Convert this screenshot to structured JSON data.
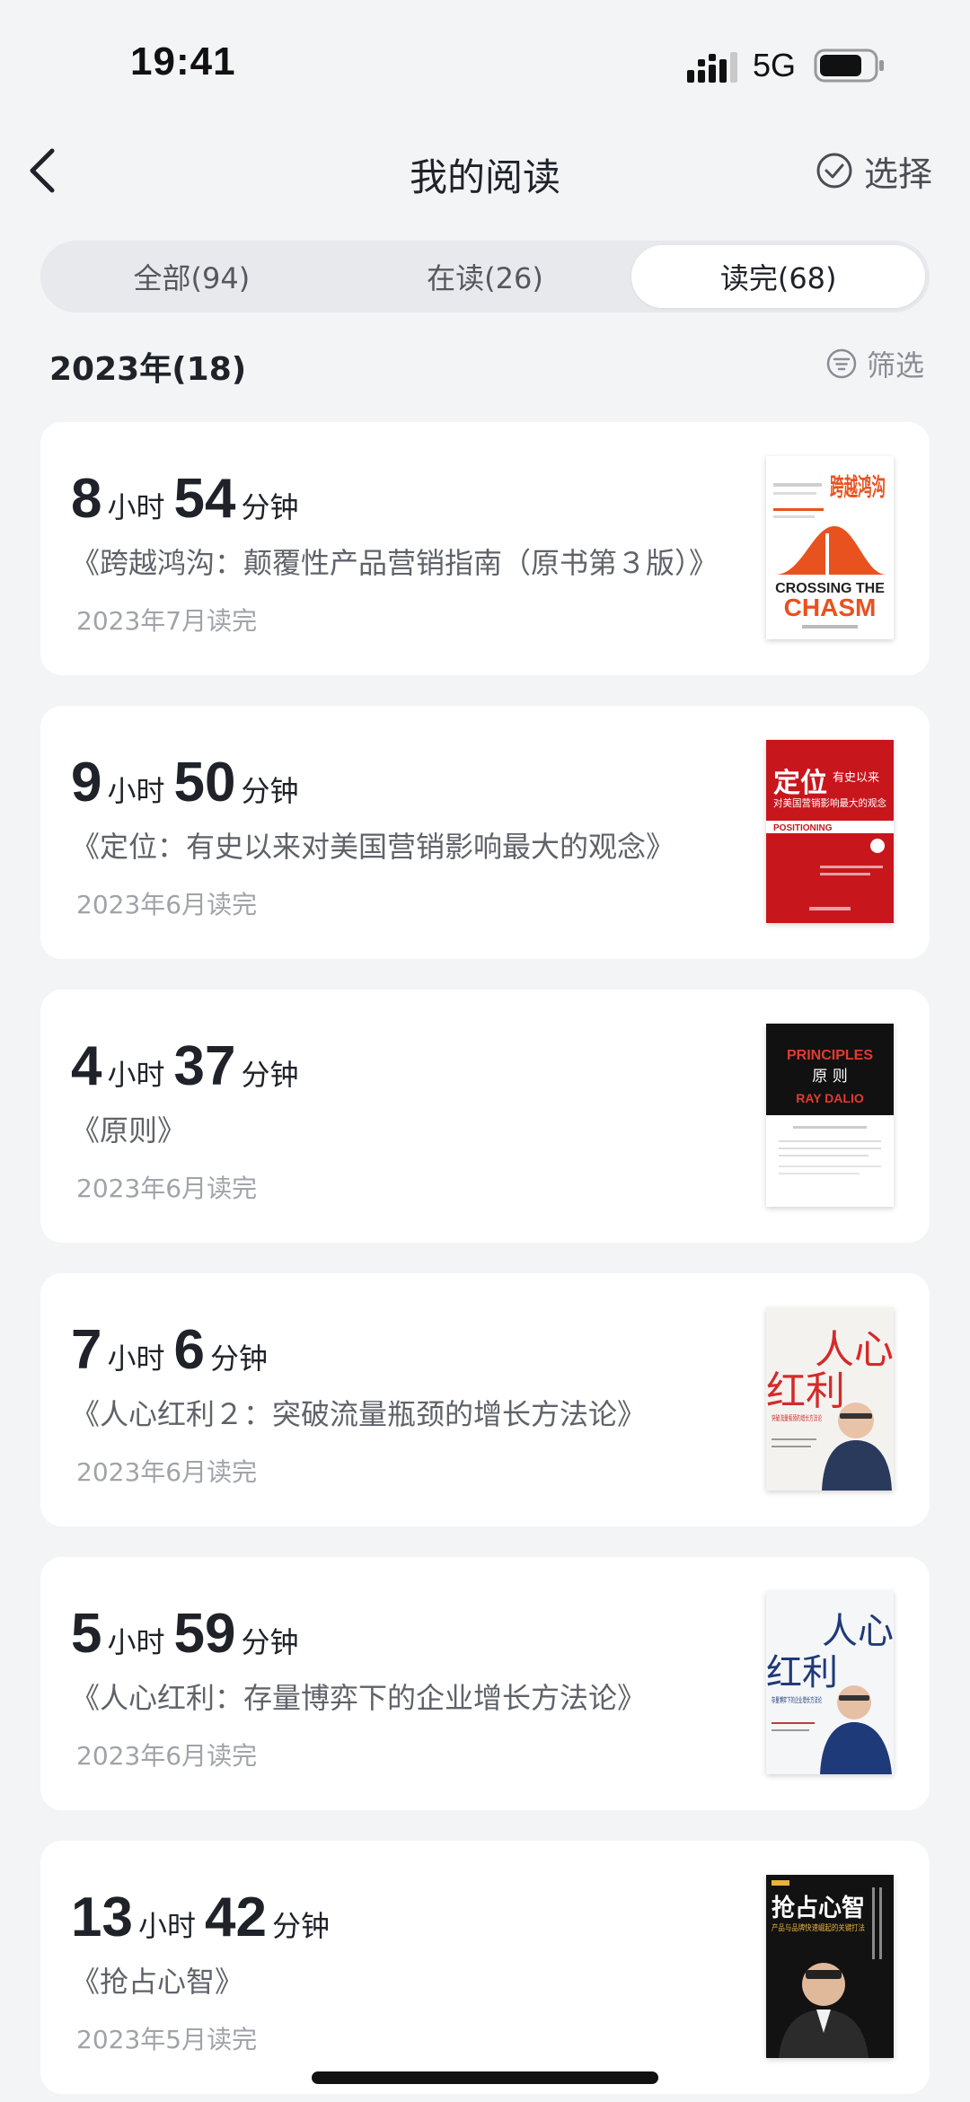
{
  "status_bar": {
    "time": "19:41",
    "network": "5G"
  },
  "nav": {
    "title": "我的阅读",
    "select_label": "选择"
  },
  "tabs": [
    {
      "label": "全部(94)",
      "active": false
    },
    {
      "label": "在读(26)",
      "active": false
    },
    {
      "label": "读完(68)",
      "active": true
    }
  ],
  "section": {
    "year_label": "2023年(18)",
    "filter_label": "筛选"
  },
  "books": [
    {
      "hours": "8",
      "hours_unit": "小时",
      "minutes": "54",
      "minutes_unit": "分钟",
      "title": "《跨越鸿沟：颠覆性产品营销指南（原书第３版）》",
      "finished": "2023年7月读完",
      "cover_icon": "crossing-the-chasm-cover",
      "cover_text": {
        "main": "跨越鸿沟",
        "en1": "CROSSING THE",
        "en2": "CHASM"
      }
    },
    {
      "hours": "9",
      "hours_unit": "小时",
      "minutes": "50",
      "minutes_unit": "分钟",
      "title": "《定位：有史以来对美国营销影响最大的观念》",
      "finished": "2023年6月读完",
      "cover_icon": "positioning-cover",
      "cover_text": {
        "main": "定位",
        "sub1": "有史以来",
        "sub2": "对美国营销影响最大的观念",
        "en": "POSITIONING"
      }
    },
    {
      "hours": "4",
      "hours_unit": "小时",
      "minutes": "37",
      "minutes_unit": "分钟",
      "title": "《原则》",
      "finished": "2023年6月读完",
      "cover_icon": "principles-cover",
      "cover_text": {
        "en1": "PRINCIPLES",
        "main": "原 则",
        "en2": "RAY DALIO"
      }
    },
    {
      "hours": "7",
      "hours_unit": "小时",
      "minutes": "6",
      "minutes_unit": "分钟",
      "title": "《人心红利２：突破流量瓶颈的增长方法论》",
      "finished": "2023年6月读完",
      "cover_icon": "renxin-hongli-2-cover",
      "cover_text": {
        "main1": "人心",
        "main2": "红利",
        "sub": "突破流量瓶颈的增长方法论"
      }
    },
    {
      "hours": "5",
      "hours_unit": "小时",
      "minutes": "59",
      "minutes_unit": "分钟",
      "title": "《人心红利：存量博弈下的企业增长方法论》",
      "finished": "2023年6月读完",
      "cover_icon": "renxin-hongli-cover",
      "cover_text": {
        "main1": "人心",
        "main2": "红利",
        "sub": "存量博弈下的企业增长方法论"
      }
    },
    {
      "hours": "13",
      "hours_unit": "小时",
      "minutes": "42",
      "minutes_unit": "分钟",
      "title": "《抢占心智》",
      "finished": "2023年5月读完",
      "cover_icon": "qiangzhan-xinzhi-cover",
      "cover_text": {
        "main": "抢占心智",
        "sub": "产品与品牌快速崛起的关键打法"
      }
    }
  ],
  "colors": {
    "accent_orange": "#e8521f",
    "positioning_red": "#c8161d",
    "background": "#f3f4f6",
    "card": "#ffffff"
  }
}
